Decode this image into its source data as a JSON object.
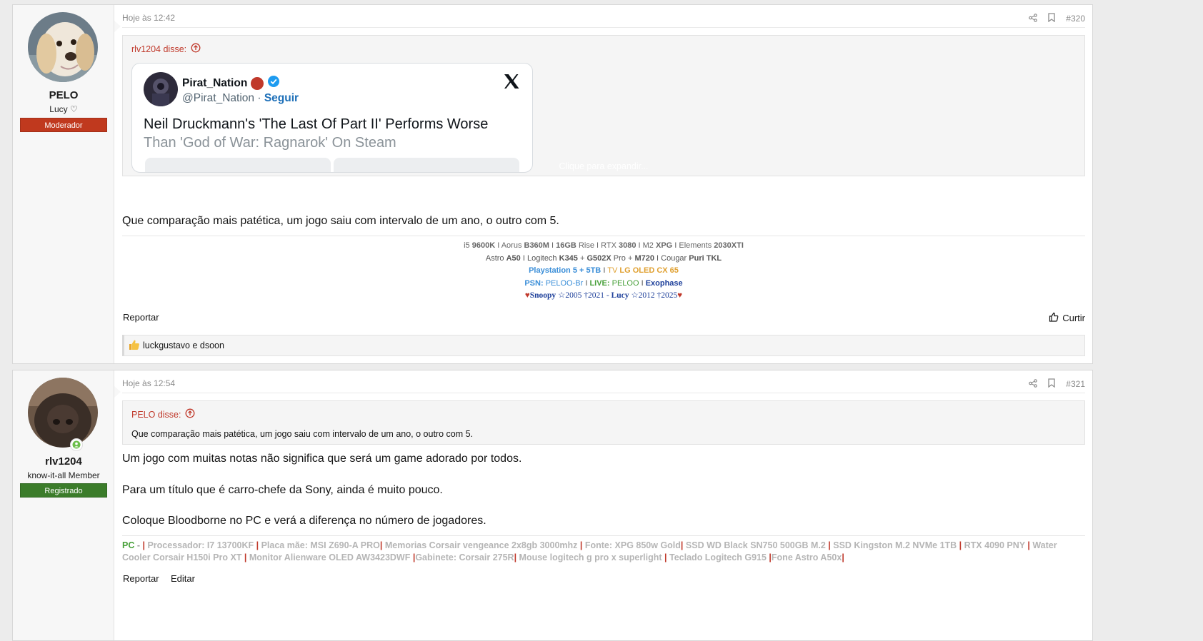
{
  "colors": {
    "moderator": "#c0391e",
    "registered": "#3b7c2a",
    "accent_red": "#c0392b",
    "x_blue": "#1d9bf0"
  },
  "posts": [
    {
      "username": "PELO",
      "user_title": "Lucy ♡",
      "badge": "Moderador",
      "date": "Hoje às 12:42",
      "number": "#320",
      "quote": {
        "author": "rlv1204 disse:",
        "tweet": {
          "display_name": "Pirat_Nation",
          "handle": "@Pirat_Nation",
          "dot": "·",
          "follow": "Seguir",
          "headline_1": "Neil Druckmann's 'The Last Of Part II' Performs Worse",
          "headline_2": "Than 'God of War: Ragnarok' On Steam"
        },
        "expand": "Clique para expandir..."
      },
      "message": "Que comparação mais patética, um jogo saiu com intervalo de um ano, o outro com 5.",
      "signature": {
        "l1": {
          "a": "i5 ",
          "b": "9600K",
          "c": " I Aorus ",
          "d": "B360M",
          "e": " I ",
          "f": "16GB",
          "g": " Rise I RTX ",
          "h": "3080",
          "i": " I M2 ",
          "j": "XPG",
          "k": " I Elements ",
          "l": "2030XTI"
        },
        "l2": {
          "a": "Astro ",
          "b": "A50",
          "c": " I Logitech ",
          "d": "K345",
          "e": " + ",
          "f": "G502X",
          "g": " Pro + ",
          "h": "M720",
          "i": " I Cougar ",
          "j": "Puri TKL"
        },
        "l3": {
          "a": "Playstation 5 + 5TB",
          "b": " I ",
          "c": "TV ",
          "d": "LG OLED CX 65"
        },
        "l4": {
          "a": "PSN: ",
          "b": "PELOO-Br",
          "c": " I ",
          "d": "LIVE: ",
          "e": "PELOO",
          "f": " I ",
          "g": "Exophase"
        },
        "l5": {
          "h1": "♥",
          "a": "Snoopy",
          "b": " ☆2005 †2021 - ",
          "c": "Lucy",
          "d": " ☆2012 †2025",
          "h2": "♥"
        }
      },
      "report": "Reportar",
      "like": "Curtir",
      "reactions": "luckgustavo e dsoon"
    },
    {
      "username": "rlv1204",
      "user_title": "know-it-all Member",
      "badge": "Registrado",
      "date": "Hoje às 12:54",
      "number": "#321",
      "quote": {
        "author": "PELO disse:",
        "text": "Que comparação mais patética, um jogo saiu com intervalo de um ano, o outro com 5."
      },
      "messages": [
        "Um jogo com muitas notas não significa que será um game adorado por todos.",
        "Para um título que é carro-chefe da Sony, ainda é muito pouco.",
        "Coloque Bloodborne no PC e verá a diferença no número de jogadores."
      ],
      "signature": {
        "pc": "PC",
        "dash": " - ",
        "bar": "|",
        "items": [
          " Processador: I7 13700KF ",
          " Placa mãe: MSI Z690-A PRO",
          " Memorias Corsair vengeance 2x8gb 3000mhz ",
          " Fonte: XPG 850w Gold",
          " SSD WD Black SN750 500GB M.2 ",
          " SSD Kingston M.2 NVMe 1TB ",
          " RTX 4090 PNY ",
          " Water Cooler Corsair H150i Pro XT ",
          " Monitor Alienware OLED AW3423DWF ",
          "Gabinete: Corsair 275R",
          " Mouse logitech g pro x superlight ",
          " Teclado Logitech G915 ",
          "Fone Astro A50x"
        ]
      },
      "report": "Reportar",
      "edit": "Editar"
    }
  ]
}
